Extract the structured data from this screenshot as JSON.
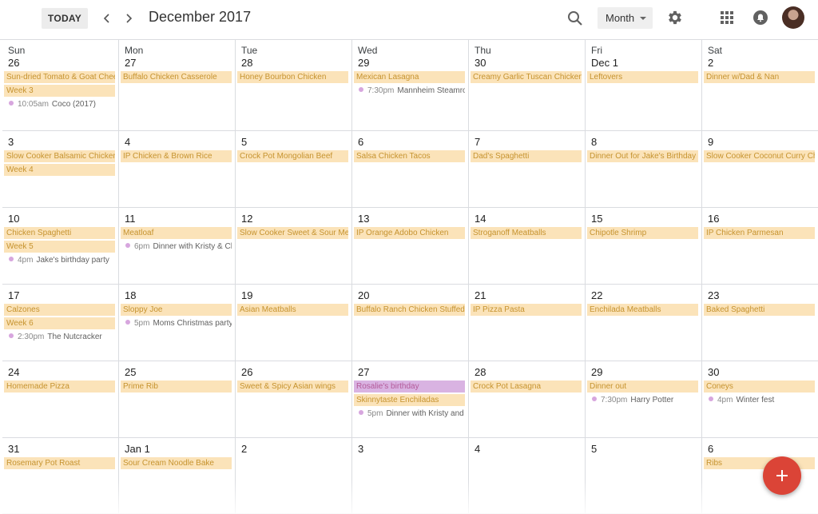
{
  "header": {
    "today_label": "TODAY",
    "month_title": "December 2017",
    "view_label": "Month"
  },
  "colors": {
    "event_bg": "#fbe3b9",
    "event_text": "#c6932f",
    "purple_event_bg": "#d9b3e2",
    "dot": "#d7a6de",
    "fab": "#db4437"
  },
  "weeks": [
    {
      "days": [
        {
          "weekday": "Sun",
          "date": "26",
          "events": [
            {
              "title": "Sun-dried Tomato & Goat Cheese"
            },
            {
              "title": "Week 3"
            },
            {
              "time": "10:05am",
              "title": "Coco (2017)"
            }
          ]
        },
        {
          "weekday": "Mon",
          "date": "27",
          "events": [
            {
              "title": "Buffalo Chicken Casserole"
            }
          ]
        },
        {
          "weekday": "Tue",
          "date": "28",
          "events": [
            {
              "title": "Honey Bourbon Chicken"
            }
          ]
        },
        {
          "weekday": "Wed",
          "date": "29",
          "events": [
            {
              "title": "Mexican Lasagna"
            },
            {
              "time": "7:30pm",
              "title": "Mannheim Steamroller"
            }
          ]
        },
        {
          "weekday": "Thu",
          "date": "30",
          "events": [
            {
              "title": "Creamy Garlic Tuscan Chicken"
            }
          ]
        },
        {
          "weekday": "Fri",
          "date": "Dec 1",
          "events": [
            {
              "title": "Leftovers"
            }
          ]
        },
        {
          "weekday": "Sat",
          "date": "2",
          "events": [
            {
              "title": "Dinner w/Dad & Nan"
            }
          ]
        }
      ]
    },
    {
      "days": [
        {
          "date": "3",
          "events": [
            {
              "title": "Slow Cooker Balsamic Chicken"
            },
            {
              "title": "Week 4"
            }
          ]
        },
        {
          "date": "4",
          "events": [
            {
              "title": "IP Chicken & Brown Rice"
            }
          ]
        },
        {
          "date": "5",
          "events": [
            {
              "title": "Crock Pot Mongolian Beef"
            }
          ]
        },
        {
          "date": "6",
          "events": [
            {
              "title": "Salsa Chicken Tacos"
            }
          ]
        },
        {
          "date": "7",
          "events": [
            {
              "title": "Dad's Spaghetti"
            }
          ]
        },
        {
          "date": "8",
          "events": [
            {
              "title": "Dinner Out for Jake's Birthday"
            }
          ]
        },
        {
          "date": "9",
          "events": [
            {
              "title": "Slow Cooker Coconut Curry Chicken"
            }
          ]
        }
      ]
    },
    {
      "days": [
        {
          "date": "10",
          "events": [
            {
              "title": "Chicken Spaghetti"
            },
            {
              "title": "Week 5"
            },
            {
              "time": "4pm",
              "title": "Jake's birthday party"
            }
          ]
        },
        {
          "date": "11",
          "events": [
            {
              "title": "Meatloaf"
            },
            {
              "time": "6pm",
              "title": "Dinner with Kristy & Chris"
            }
          ]
        },
        {
          "date": "12",
          "events": [
            {
              "title": "Slow Cooker Sweet & Sour Meatballs"
            }
          ]
        },
        {
          "date": "13",
          "events": [
            {
              "title": "IP Orange Adobo Chicken"
            }
          ]
        },
        {
          "date": "14",
          "events": [
            {
              "title": "Stroganoff Meatballs"
            }
          ]
        },
        {
          "date": "15",
          "events": [
            {
              "title": "Chipotle Shrimp"
            }
          ]
        },
        {
          "date": "16",
          "events": [
            {
              "title": "IP Chicken Parmesan"
            }
          ]
        }
      ]
    },
    {
      "days": [
        {
          "date": "17",
          "events": [
            {
              "title": "Calzones"
            },
            {
              "title": "Week 6"
            },
            {
              "time": "2:30pm",
              "title": "The Nutcracker"
            }
          ]
        },
        {
          "date": "18",
          "events": [
            {
              "title": "Sloppy Joe"
            },
            {
              "time": "5pm",
              "title": "Moms Christmas party"
            }
          ]
        },
        {
          "date": "19",
          "events": [
            {
              "title": "Asian Meatballs"
            }
          ]
        },
        {
          "date": "20",
          "events": [
            {
              "title": "Buffalo Ranch Chicken Stuffed Shells"
            }
          ]
        },
        {
          "date": "21",
          "events": [
            {
              "title": "IP Pizza Pasta"
            }
          ]
        },
        {
          "date": "22",
          "events": [
            {
              "title": "Enchilada Meatballs"
            }
          ]
        },
        {
          "date": "23",
          "events": [
            {
              "title": "Baked Spaghetti"
            }
          ]
        }
      ]
    },
    {
      "days": [
        {
          "date": "24",
          "events": [
            {
              "title": "Homemade Pizza"
            }
          ]
        },
        {
          "date": "25",
          "events": [
            {
              "title": "Prime Rib"
            }
          ]
        },
        {
          "date": "26",
          "events": [
            {
              "title": "Sweet & Spicy Asian wings"
            }
          ]
        },
        {
          "date": "27",
          "events": [
            {
              "title": "Rosalie's birthday",
              "color": "purple"
            },
            {
              "title": "Skinnytaste Enchiladas"
            },
            {
              "time": "5pm",
              "title": "Dinner with Kristy and Chris"
            }
          ]
        },
        {
          "date": "28",
          "events": [
            {
              "title": "Crock Pot Lasagna"
            }
          ]
        },
        {
          "date": "29",
          "events": [
            {
              "title": "Dinner out"
            },
            {
              "time": "7:30pm",
              "title": "Harry Potter"
            }
          ]
        },
        {
          "date": "30",
          "events": [
            {
              "title": "Coneys"
            },
            {
              "time": "4pm",
              "title": "Winter fest"
            }
          ]
        }
      ]
    },
    {
      "days": [
        {
          "date": "31",
          "events": [
            {
              "title": "Rosemary Pot Roast"
            }
          ]
        },
        {
          "date": "Jan 1",
          "events": [
            {
              "title": "Sour Cream Noodle Bake"
            }
          ]
        },
        {
          "date": "2",
          "events": []
        },
        {
          "date": "3",
          "events": []
        },
        {
          "date": "4",
          "events": []
        },
        {
          "date": "5",
          "events": []
        },
        {
          "date": "6",
          "events": [
            {
              "title": "Ribs"
            }
          ]
        }
      ]
    }
  ]
}
